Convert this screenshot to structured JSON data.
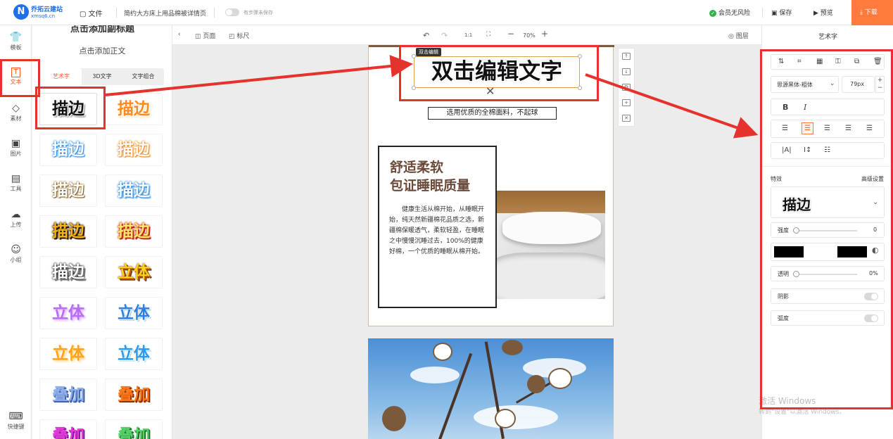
{
  "app": {
    "brand_name": "乔拓云建站",
    "brand_domain": "xmsq6.cn",
    "logo_letter": "N"
  },
  "topbar": {
    "file_label": "文件",
    "doc_title": "简约大方床上用品棉被详情页",
    "autosave_label": "有步骤未保存",
    "risk_label": "会员无风险",
    "save_label": "保存",
    "preview_label": "预览",
    "download_label": "下载"
  },
  "leftnav": [
    {
      "label": "模板",
      "icon": "tshirt-icon",
      "glyph": "👕"
    },
    {
      "label": "文本",
      "icon": "text-icon",
      "glyph": "T",
      "active": true
    },
    {
      "label": "素材",
      "icon": "shapes-icon",
      "glyph": "◇"
    },
    {
      "label": "图片",
      "icon": "image-icon",
      "glyph": "▣"
    },
    {
      "label": "工具",
      "icon": "toolbox-icon",
      "glyph": "▤"
    },
    {
      "label": "上传",
      "icon": "cloud-upload-icon",
      "glyph": "☁"
    },
    {
      "label": "小组",
      "icon": "group-icon",
      "glyph": "☺"
    },
    {
      "label": "快捷键",
      "icon": "keyboard-icon",
      "glyph": "⌨"
    }
  ],
  "panel": {
    "add_subtitle": "点击添加副标题",
    "add_body": "点击添加正文",
    "tabs": [
      "艺术字",
      "3D文字",
      "文字组合"
    ],
    "tiles": [
      {
        "text": "描边",
        "color": "#111111",
        "shadow": "0 0 0 #fff, 1px 1px 0 #fff, -1px -1px 0 #fff, 2px 2px 2px #777"
      },
      {
        "text": "描边",
        "color": "#ff8a22",
        "shadow": "1px 1px 0 #fff, -1px -1px 0 #fff, 2px 2px 3px #ffd7a8"
      },
      {
        "text": "描边",
        "color": "#ffffff",
        "shadow": "0 0 2px #2e8ee6, 0 0 3px #2e8ee6, 1px 1px 0 #2e8ee6"
      },
      {
        "text": "描边",
        "color": "#ffffff",
        "shadow": "0 0 2px #f08a1f, 0 0 3px #f08a1f, 1px 1px 0 #f08a1f"
      },
      {
        "text": "描边",
        "color": "#ffffff",
        "shadow": "0 0 2px #6b4a1e, 0 0 3px #c9a15a, 1px 1px 0 #6b4a1e"
      },
      {
        "text": "描边",
        "color": "#ffffff",
        "shadow": "0 0 2px #1f7fd6, 0 0 3px #1f7fd6, 2px 2px 0 #89c2f2"
      },
      {
        "text": "描边",
        "color": "#f6b21a",
        "shadow": "0 0 2px #2a1a00, 0 0 3px #2a1a00, 2px 2px 0 #2a1a00"
      },
      {
        "text": "描边",
        "color": "#ffe46b",
        "shadow": "0 0 2px #c0281e, 0 0 3px #c0281e, 2px 2px 0 #c0281e"
      },
      {
        "text": "描边",
        "color": "#ffffff",
        "shadow": "0 0 2px #222, 0 0 3px #222, 3px 3px 0 #888"
      },
      {
        "text": "立体",
        "color": "#ffd21a",
        "shadow": "0 0 2px #5a2a00, 2px 2px 0 #c55a00, 3px 3px 0 #5a2a00"
      },
      {
        "text": "立体",
        "color": "#b86cf5",
        "shadow": "1px 1px 0 #e6c8ff, 2px 2px 3px #d9b3ff"
      },
      {
        "text": "立体",
        "color": "#2f7fe0",
        "shadow": "1px 1px 0 #fff, 2px 2px 0 #9cc9f5"
      },
      {
        "text": "立体",
        "color": "#ffa31a",
        "shadow": "1px 1px 0 #ffe1a6, 2px 2px 3px #ffd18a"
      },
      {
        "text": "立体",
        "color": "#2a9bf0",
        "shadow": "1px 1px 0 #fff, 2px 2px 0 #a8d8ff"
      },
      {
        "text": "叠加",
        "color": "#8fb0e8",
        "shadow": "1px 1px 0 #3b5ea8, 2px 2px 0 #3b5ea8"
      },
      {
        "text": "叠加",
        "color": "#ff7a1a",
        "shadow": "1px 1px 0 #8a2b00, 2px 2px 0 #8a2b00"
      },
      {
        "text": "叠加",
        "color": "#e23bd8",
        "shadow": "1px 1px 0 #7d1b9a, 2px 2px 0 #7d1b9a"
      },
      {
        "text": "叠加",
        "color": "#59d16a",
        "shadow": "1px 1px 0 #1f6a2c, 2px 2px 0 #1f6a2c"
      }
    ]
  },
  "toolbar2": {
    "page_label": "页面",
    "ruler_label": "标尺",
    "ratio_label": "1:1",
    "zoom": "70%",
    "layers_label": "图层"
  },
  "canvas": {
    "edit_badge": "双击编辑",
    "headline": "双击编辑文字",
    "subtitle": "选用优质的全棉面料，不起球",
    "card_title_line1": "舒适柔软",
    "card_title_line2": "包证睡眠质量",
    "card_body": "健康生活从棉开始，从睡眠开始，纯天然新疆棉花品质之选，新疆棉保暖透气，柔软轻盈，在睡眠之中慢慢沉睡过去，100%的健康好棉，一个优质的睡眠从棉开始。"
  },
  "rightpanel": {
    "title": "艺术字",
    "font_name": "思源黑体-粗体",
    "font_size": "79px",
    "effects_label": "特效",
    "advanced_label": "高级设置",
    "effect_preview": "描边",
    "strength_label": "强度",
    "strength_value": "0",
    "stroke_color": "#000000",
    "fill_color": "#000000",
    "opacity_label": "透明",
    "opacity_value": "0%",
    "shadow_label": "阴影",
    "curve_label": "弧度"
  },
  "watermark": {
    "line1": "激活 Windows",
    "line2": "转到\"设置\"以激活 Windows。"
  }
}
